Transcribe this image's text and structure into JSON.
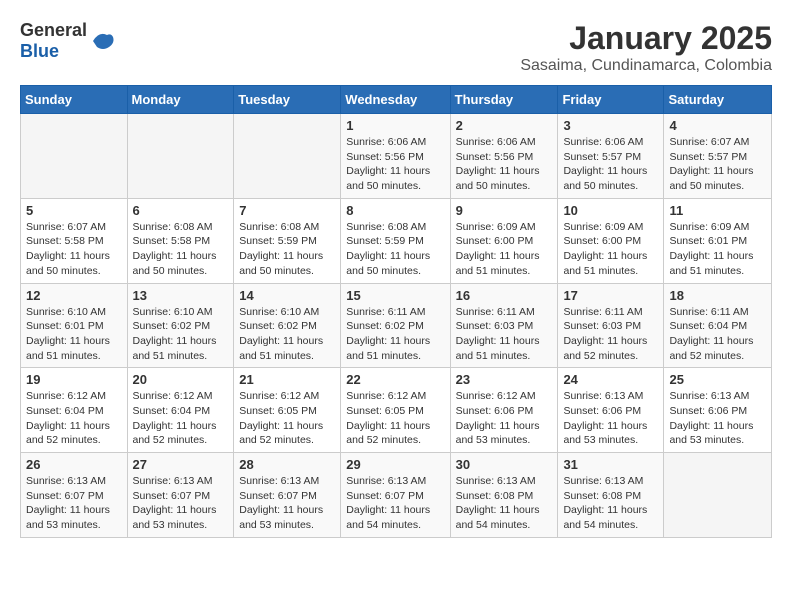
{
  "header": {
    "logo_general": "General",
    "logo_blue": "Blue",
    "calendar_title": "January 2025",
    "calendar_subtitle": "Sasaima, Cundinamarca, Colombia"
  },
  "days_of_week": [
    "Sunday",
    "Monday",
    "Tuesday",
    "Wednesday",
    "Thursday",
    "Friday",
    "Saturday"
  ],
  "weeks": [
    [
      {
        "day": "",
        "info": ""
      },
      {
        "day": "",
        "info": ""
      },
      {
        "day": "",
        "info": ""
      },
      {
        "day": "1",
        "info": "Sunrise: 6:06 AM\nSunset: 5:56 PM\nDaylight: 11 hours and 50 minutes."
      },
      {
        "day": "2",
        "info": "Sunrise: 6:06 AM\nSunset: 5:56 PM\nDaylight: 11 hours and 50 minutes."
      },
      {
        "day": "3",
        "info": "Sunrise: 6:06 AM\nSunset: 5:57 PM\nDaylight: 11 hours and 50 minutes."
      },
      {
        "day": "4",
        "info": "Sunrise: 6:07 AM\nSunset: 5:57 PM\nDaylight: 11 hours and 50 minutes."
      }
    ],
    [
      {
        "day": "5",
        "info": "Sunrise: 6:07 AM\nSunset: 5:58 PM\nDaylight: 11 hours and 50 minutes."
      },
      {
        "day": "6",
        "info": "Sunrise: 6:08 AM\nSunset: 5:58 PM\nDaylight: 11 hours and 50 minutes."
      },
      {
        "day": "7",
        "info": "Sunrise: 6:08 AM\nSunset: 5:59 PM\nDaylight: 11 hours and 50 minutes."
      },
      {
        "day": "8",
        "info": "Sunrise: 6:08 AM\nSunset: 5:59 PM\nDaylight: 11 hours and 50 minutes."
      },
      {
        "day": "9",
        "info": "Sunrise: 6:09 AM\nSunset: 6:00 PM\nDaylight: 11 hours and 51 minutes."
      },
      {
        "day": "10",
        "info": "Sunrise: 6:09 AM\nSunset: 6:00 PM\nDaylight: 11 hours and 51 minutes."
      },
      {
        "day": "11",
        "info": "Sunrise: 6:09 AM\nSunset: 6:01 PM\nDaylight: 11 hours and 51 minutes."
      }
    ],
    [
      {
        "day": "12",
        "info": "Sunrise: 6:10 AM\nSunset: 6:01 PM\nDaylight: 11 hours and 51 minutes."
      },
      {
        "day": "13",
        "info": "Sunrise: 6:10 AM\nSunset: 6:02 PM\nDaylight: 11 hours and 51 minutes."
      },
      {
        "day": "14",
        "info": "Sunrise: 6:10 AM\nSunset: 6:02 PM\nDaylight: 11 hours and 51 minutes."
      },
      {
        "day": "15",
        "info": "Sunrise: 6:11 AM\nSunset: 6:02 PM\nDaylight: 11 hours and 51 minutes."
      },
      {
        "day": "16",
        "info": "Sunrise: 6:11 AM\nSunset: 6:03 PM\nDaylight: 11 hours and 51 minutes."
      },
      {
        "day": "17",
        "info": "Sunrise: 6:11 AM\nSunset: 6:03 PM\nDaylight: 11 hours and 52 minutes."
      },
      {
        "day": "18",
        "info": "Sunrise: 6:11 AM\nSunset: 6:04 PM\nDaylight: 11 hours and 52 minutes."
      }
    ],
    [
      {
        "day": "19",
        "info": "Sunrise: 6:12 AM\nSunset: 6:04 PM\nDaylight: 11 hours and 52 minutes."
      },
      {
        "day": "20",
        "info": "Sunrise: 6:12 AM\nSunset: 6:04 PM\nDaylight: 11 hours and 52 minutes."
      },
      {
        "day": "21",
        "info": "Sunrise: 6:12 AM\nSunset: 6:05 PM\nDaylight: 11 hours and 52 minutes."
      },
      {
        "day": "22",
        "info": "Sunrise: 6:12 AM\nSunset: 6:05 PM\nDaylight: 11 hours and 52 minutes."
      },
      {
        "day": "23",
        "info": "Sunrise: 6:12 AM\nSunset: 6:06 PM\nDaylight: 11 hours and 53 minutes."
      },
      {
        "day": "24",
        "info": "Sunrise: 6:13 AM\nSunset: 6:06 PM\nDaylight: 11 hours and 53 minutes."
      },
      {
        "day": "25",
        "info": "Sunrise: 6:13 AM\nSunset: 6:06 PM\nDaylight: 11 hours and 53 minutes."
      }
    ],
    [
      {
        "day": "26",
        "info": "Sunrise: 6:13 AM\nSunset: 6:07 PM\nDaylight: 11 hours and 53 minutes."
      },
      {
        "day": "27",
        "info": "Sunrise: 6:13 AM\nSunset: 6:07 PM\nDaylight: 11 hours and 53 minutes."
      },
      {
        "day": "28",
        "info": "Sunrise: 6:13 AM\nSunset: 6:07 PM\nDaylight: 11 hours and 53 minutes."
      },
      {
        "day": "29",
        "info": "Sunrise: 6:13 AM\nSunset: 6:07 PM\nDaylight: 11 hours and 54 minutes."
      },
      {
        "day": "30",
        "info": "Sunrise: 6:13 AM\nSunset: 6:08 PM\nDaylight: 11 hours and 54 minutes."
      },
      {
        "day": "31",
        "info": "Sunrise: 6:13 AM\nSunset: 6:08 PM\nDaylight: 11 hours and 54 minutes."
      },
      {
        "day": "",
        "info": ""
      }
    ]
  ]
}
